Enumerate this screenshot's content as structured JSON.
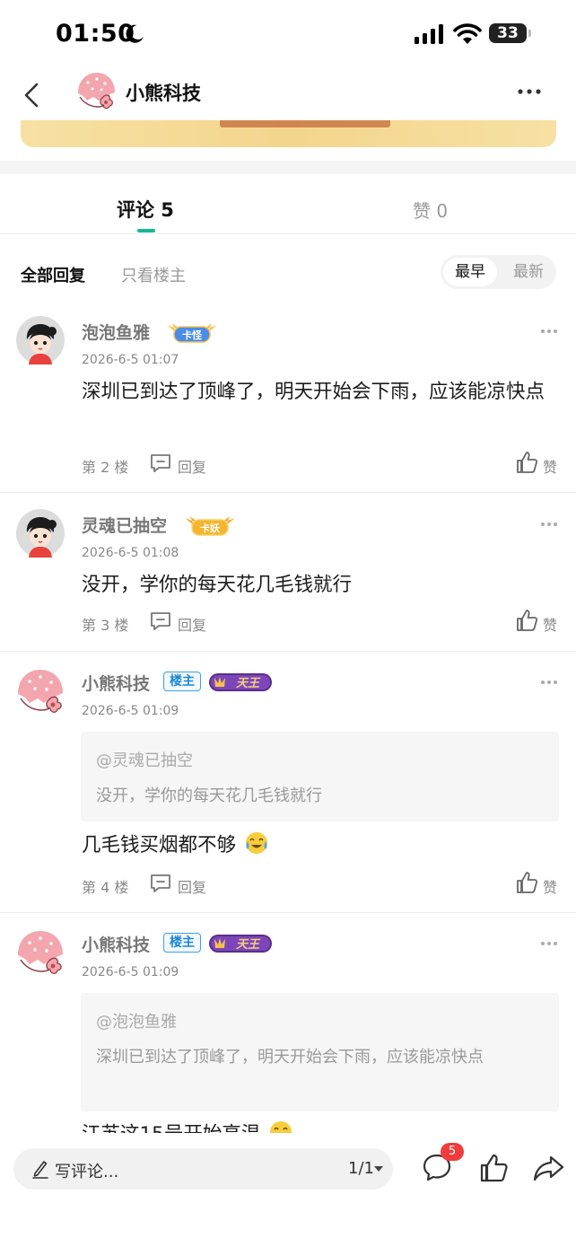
{
  "status_bar": {
    "time": "01:50",
    "battery": "33"
  },
  "header": {
    "title": "小熊科技"
  },
  "tabs": {
    "comments_label": "评论 5",
    "likes_label": "赞 0"
  },
  "filters": {
    "all": "全部回复",
    "owner_only": "只看楼主",
    "sort_earliest": "最早",
    "sort_newest": "最新"
  },
  "comments": [
    {
      "name": "泡泡鱼雅",
      "badge": "卡怪",
      "time": "2026-6-5 01:07",
      "text": "深圳已到达了顶峰了，明天开始会下雨，应该能凉快点",
      "floor": "第 2 楼",
      "reply_label": "回复",
      "like_label": "赞"
    },
    {
      "name": "灵魂已抽空",
      "badge": "卡妖",
      "time": "2026-6-5 01:08",
      "text": "没开，学你的每天花几毛钱就行",
      "floor": "第 3 楼",
      "reply_label": "回复",
      "like_label": "赞"
    },
    {
      "name": "小熊科技",
      "owner_tag": "楼主",
      "badge": "天王",
      "time": "2026-6-5 01:09",
      "quote_name": "@灵魂已抽空",
      "quote_text": "没开，学你的每天花几毛钱就行",
      "text": "几毛钱买烟都不够",
      "floor": "第 4 楼",
      "reply_label": "回复",
      "like_label": "赞"
    },
    {
      "name": "小熊科技",
      "owner_tag": "楼主",
      "badge": "天王",
      "time": "2026-6-5 01:09",
      "quote_name": "@泡泡鱼雅",
      "quote_text": "深圳已到达了顶峰了，明天开始会下雨，应该能凉快点",
      "text": "江苏这15号开始高温"
    }
  ],
  "bottom_bar": {
    "input_placeholder": "写评论...",
    "page": "1/1",
    "comment_count": "5"
  },
  "colors": {
    "accent": "#17b890",
    "owner_tag": "#1b86d8",
    "badge_red": "#f03c3c"
  }
}
